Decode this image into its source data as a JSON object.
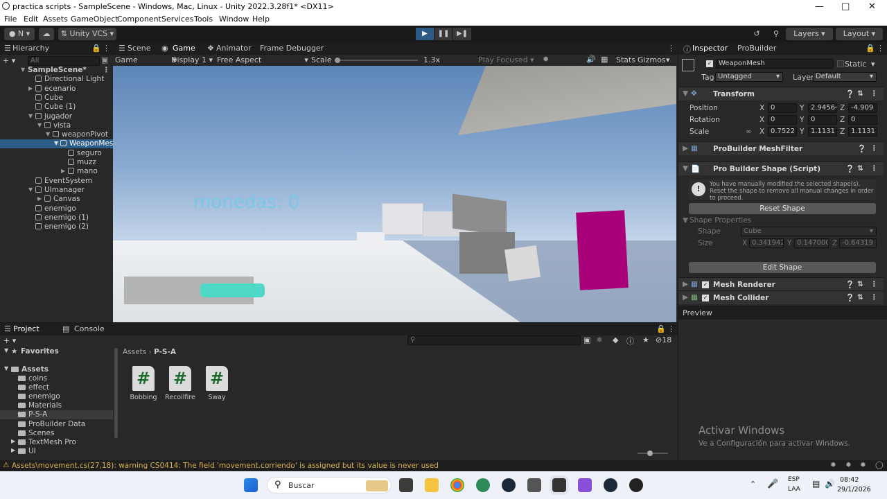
{
  "window": {
    "title": "practica scripts - SampleScene - Windows, Mac, Linux - Unity 2022.3.28f1* <DX11>"
  },
  "menu": [
    "File",
    "Edit",
    "Assets",
    "GameObject",
    "Component",
    "Services",
    "Tools",
    "Window",
    "Help"
  ],
  "toolbar": {
    "account_initial": "N",
    "vcs": "Unity VCS",
    "layers": "Layers",
    "layout": "Layout"
  },
  "hierarchy": {
    "tab": "Hierarchy",
    "search_placeholder": "All",
    "items": [
      {
        "label": "SampleScene*",
        "bold": true
      },
      {
        "label": "Directional Light"
      },
      {
        "label": "ecenario"
      },
      {
        "label": "Cube"
      },
      {
        "label": "Cube (1)"
      },
      {
        "label": "jugador"
      },
      {
        "label": "vista"
      },
      {
        "label": "weaponPivot"
      },
      {
        "label": "WeaponMes"
      },
      {
        "label": "seguro"
      },
      {
        "label": "muzz"
      },
      {
        "label": "mano"
      },
      {
        "label": "EventSystem"
      },
      {
        "label": "UImanager"
      },
      {
        "label": "Canvas"
      },
      {
        "label": "enemigo"
      },
      {
        "label": "enemigo (1)"
      },
      {
        "label": "enemigo (2)"
      }
    ]
  },
  "scene_tabs": {
    "scene": "Scene",
    "game": "Game",
    "animator": "Animator",
    "frame_debugger": "Frame Debugger"
  },
  "game_toolbar": {
    "mode": "Game",
    "display": "Display 1",
    "aspect": "Free Aspect",
    "scale_label": "Scale",
    "scale_value": "1.3x",
    "play_focused": "Play Focused",
    "stats": "Stats",
    "gizmos": "Gizmos"
  },
  "game_view": {
    "coins_text": "monedas: 0",
    "health_fraction": 0.6
  },
  "inspector": {
    "tabs": {
      "inspector": "Inspector",
      "probuilder": "ProBuilder"
    },
    "object_name": "WeaponMesh",
    "static_label": "Static",
    "tag_label": "Tag",
    "tag_value": "Untagged",
    "layer_label": "Layer",
    "layer_value": "Default",
    "transform": {
      "title": "Transform",
      "position": {
        "label": "Position",
        "x": "0",
        "y": "2.94564",
        "z": "-4.909"
      },
      "rotation": {
        "label": "Rotation",
        "x": "0",
        "y": "0",
        "z": "0"
      },
      "scale": {
        "label": "Scale",
        "x": "0.7522",
        "y": "1.1131",
        "z": "1.1131"
      }
    },
    "meshfilter_title": "ProBuilder MeshFilter",
    "shape_script_title": "Pro Builder Shape (Script)",
    "warning": "You have manually modified the selected shape(s). Reset the shape to remove all manual changes in order to proceed.",
    "reset_shape": "Reset Shape",
    "shape_properties": "Shape Properties",
    "shape_label": "Shape",
    "shape_value": "Cube",
    "size_label": "Size",
    "size_x": "0.341942",
    "size_y": "0.147000",
    "size_z": "-0.64319",
    "edit_shape": "Edit Shape",
    "mesh_renderer": "Mesh Renderer",
    "mesh_collider": "Mesh Collider",
    "preview": "Preview",
    "activate_title": "Activar Windows",
    "activate_sub": "Ve a Configuración para activar Windows."
  },
  "project": {
    "tabs": {
      "project": "Project",
      "console": "Console"
    },
    "favorites": "Favorites",
    "assets_root": "Assets",
    "folders": [
      "coins",
      "effect",
      "enemigo",
      "Materials",
      "P-S-A",
      "ProBuilder Data",
      "Scenes",
      "TextMesh Pro",
      "UI"
    ],
    "breadcrumb_root": "Assets",
    "breadcrumb_current": "P-S-A",
    "files": [
      "Bobbing",
      "Recoilfire",
      "Sway"
    ],
    "hidden_count": "18"
  },
  "status_bar": {
    "message": "Assets\\movement.cs(27,18): warning CS0414: The field 'movement.corriendo' is assigned but its value is never used"
  },
  "taskbar": {
    "search_placeholder": "Buscar",
    "lang": "ESP",
    "lang_sub": "LAA",
    "time": "08:42",
    "date": "29/1/2026"
  }
}
